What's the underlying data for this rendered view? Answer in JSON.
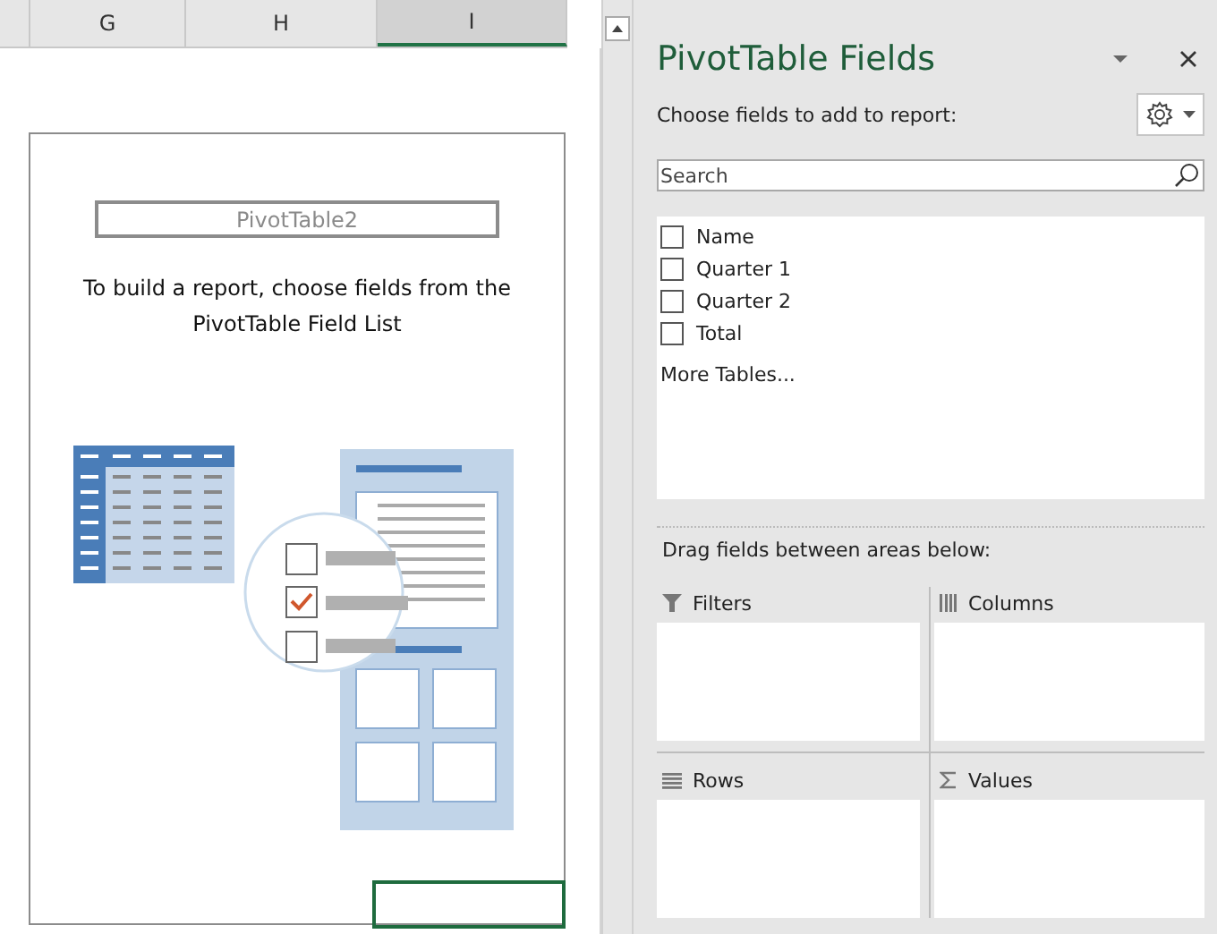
{
  "sheet": {
    "columns": [
      {
        "label": "G",
        "selected": false
      },
      {
        "label": "H",
        "selected": false
      },
      {
        "label": "I",
        "selected": true
      }
    ],
    "pivot": {
      "name": "PivotTable2",
      "message": "To build a report, choose fields from the PivotTable Field List"
    }
  },
  "panel": {
    "title": "PivotTable Fields",
    "choose_label": "Choose fields to add to report:",
    "search": {
      "placeholder": "Search"
    },
    "fields": [
      {
        "label": "Name",
        "checked": false
      },
      {
        "label": "Quarter 1",
        "checked": false
      },
      {
        "label": "Quarter 2",
        "checked": false
      },
      {
        "label": "Total",
        "checked": false
      }
    ],
    "more_tables": "More Tables...",
    "drag_label": "Drag fields between areas below:",
    "areas": [
      {
        "kind": "filters",
        "label": "Filters"
      },
      {
        "kind": "columns",
        "label": "Columns"
      },
      {
        "kind": "rows",
        "label": "Rows"
      },
      {
        "kind": "values",
        "label": "Values"
      }
    ]
  }
}
